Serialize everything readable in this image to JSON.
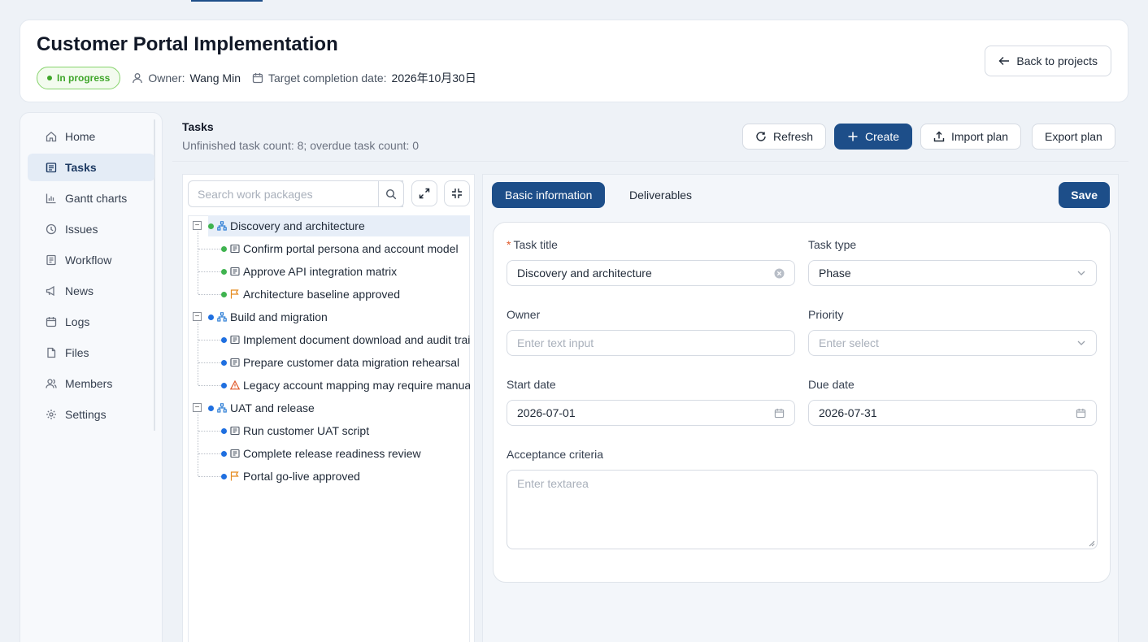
{
  "project": {
    "title": "Customer Portal Implementation",
    "status": "In progress",
    "owner_label": "Owner:",
    "owner_value": "Wang Min",
    "target_label": "Target completion date:",
    "target_value": "2026年10月30日",
    "back_button": "Back to projects"
  },
  "sidebar": {
    "items": [
      {
        "label": "Home",
        "icon": "home-icon"
      },
      {
        "label": "Tasks",
        "icon": "tasks-icon",
        "active": true
      },
      {
        "label": "Gantt charts",
        "icon": "gantt-chart-icon"
      },
      {
        "label": "Issues",
        "icon": "issues-icon"
      },
      {
        "label": "Workflow",
        "icon": "workflow-icon"
      },
      {
        "label": "News",
        "icon": "megaphone-icon"
      },
      {
        "label": "Logs",
        "icon": "calendar-icon"
      },
      {
        "label": "Files",
        "icon": "file-icon"
      },
      {
        "label": "Members",
        "icon": "members-icon"
      },
      {
        "label": "Settings",
        "icon": "gear-icon"
      }
    ]
  },
  "tasks": {
    "title": "Tasks",
    "summary": "Unfinished task count: 8; overdue task count: 0",
    "buttons": {
      "refresh": "Refresh",
      "create": "Create",
      "import": "Import plan",
      "export": "Export plan"
    },
    "search_placeholder": "Search work packages"
  },
  "tree": [
    {
      "label": "Discovery and architecture",
      "level": 0,
      "status_color": "#3fb34f",
      "icon": "phase-icon",
      "selected": true
    },
    {
      "label": "Confirm portal persona and account model",
      "level": 1,
      "status_color": "#3fb34f",
      "icon": "task-icon"
    },
    {
      "label": "Approve API integration matrix",
      "level": 1,
      "status_color": "#3fb34f",
      "icon": "task-icon"
    },
    {
      "label": "Architecture baseline approved",
      "level": 1,
      "status_color": "#3fb34f",
      "icon": "milestone-flag-icon"
    },
    {
      "label": "Build and migration",
      "level": 0,
      "status_color": "#1f6fe0",
      "icon": "phase-icon"
    },
    {
      "label": "Implement document download and audit trail",
      "level": 1,
      "status_color": "#1f6fe0",
      "icon": "task-icon"
    },
    {
      "label": "Prepare customer data migration rehearsal",
      "level": 1,
      "status_color": "#1f6fe0",
      "icon": "task-icon"
    },
    {
      "label": "Legacy account mapping may require manual review",
      "level": 1,
      "status_color": "#1f6fe0",
      "icon": "warning-icon"
    },
    {
      "label": "UAT and release",
      "level": 0,
      "status_color": "#1f6fe0",
      "icon": "phase-icon"
    },
    {
      "label": "Run customer UAT script",
      "level": 1,
      "status_color": "#1f6fe0",
      "icon": "task-icon"
    },
    {
      "label": "Complete release readiness review",
      "level": 1,
      "status_color": "#1f6fe0",
      "icon": "task-icon"
    },
    {
      "label": "Portal go-live approved",
      "level": 1,
      "status_color": "#1f6fe0",
      "icon": "milestone-flag-icon"
    }
  ],
  "detail": {
    "tabs": [
      "Basic information",
      "Deliverables"
    ],
    "save": "Save",
    "fields": {
      "task_title_label": "Task title",
      "task_title_value": "Discovery and architecture",
      "task_type_label": "Task type",
      "task_type_value": "Phase",
      "owner_label": "Owner",
      "owner_placeholder": "Enter text input",
      "priority_label": "Priority",
      "priority_placeholder": "Enter select",
      "start_label": "Start date",
      "start_value": "2026-07-01",
      "due_label": "Due date",
      "due_value": "2026-07-31",
      "acceptance_label": "Acceptance criteria",
      "acceptance_placeholder": "Enter textarea"
    }
  },
  "colors": {
    "primary": "#1d4e89",
    "success": "#3fa62a",
    "info": "#1f6fe0",
    "warning": "#e58a1f"
  }
}
